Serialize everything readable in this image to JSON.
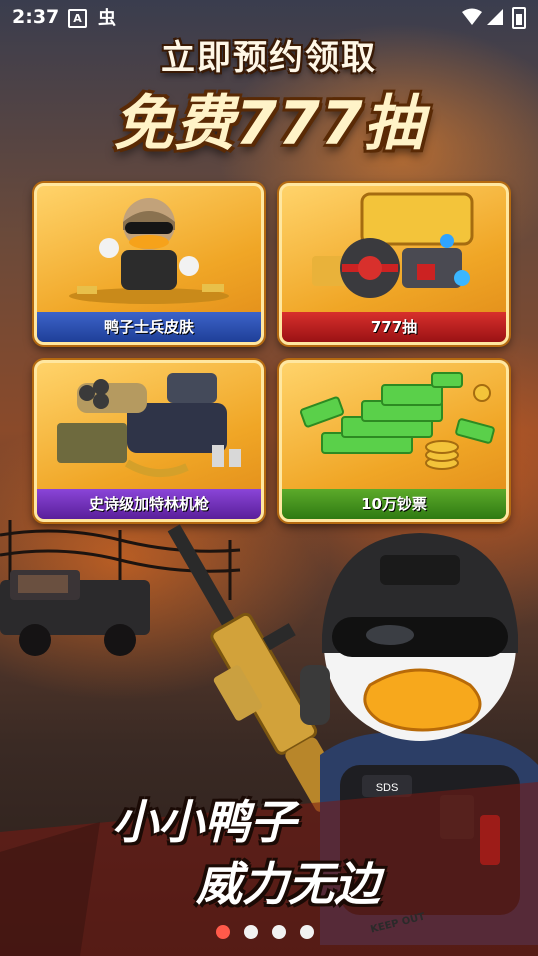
{
  "status_bar": {
    "time": "2:37",
    "icons": [
      "text-a-icon",
      "bug-icon",
      "wifi-icon",
      "cell-signal-icon",
      "battery-charging-icon"
    ]
  },
  "headline": {
    "line1": "立即预约领取",
    "line2": "免费777抽"
  },
  "rewards": [
    {
      "label": "鸭子士兵皮肤",
      "band_color": "#2e52b8",
      "icon": "duck-soldier-icon"
    },
    {
      "label": "777抽",
      "band_color": "#c01e1e",
      "icon": "treasure-chest-icon"
    },
    {
      "label": "史诗级加特林机枪",
      "band_color": "#7a35c8",
      "icon": "gatling-gun-icon"
    },
    {
      "label": "10万钞票",
      "band_color": "#4a9a20",
      "icon": "cash-stack-icon"
    }
  ],
  "slogan": {
    "line1": "小小鸭子",
    "line2": "威力无边"
  },
  "vest_patch": "SDS",
  "tape_text": "KEEP OUT",
  "carousel": {
    "total": 4,
    "active_index": 0
  },
  "colors": {
    "accent_gold": "#f0a626",
    "active_dot": "#ff5a4a"
  }
}
